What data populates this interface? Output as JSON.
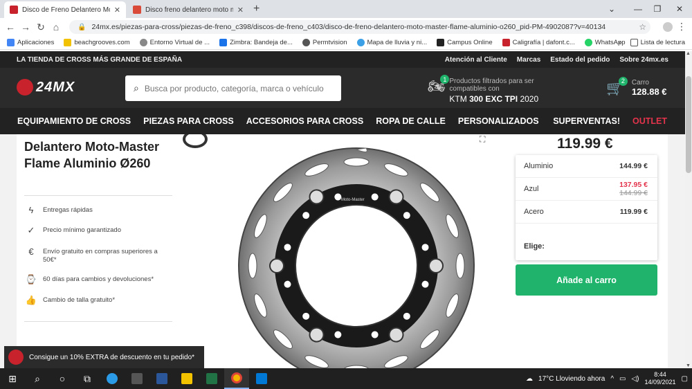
{
  "browser": {
    "tabs": [
      {
        "title": "Disco de Freno Delantero Moto-M",
        "active": true,
        "favicon_color": "#c8232c"
      },
      {
        "title": "Disco freno delantero moto más",
        "active": false,
        "favicon_color": "#d94a38"
      }
    ],
    "new_tab": "+",
    "url": "24mx.es/piezas-para-cross/piezas-de-freno_c398/discos-de-freno_c403/disco-de-freno-delantero-moto-master-flame-aluminio-o260_pid-PM-4902087?v=40134",
    "bookmarks": [
      {
        "label": "Aplicaciones",
        "color": "#4285f4"
      },
      {
        "label": "beachgrooves.com",
        "color": "#f2c200"
      },
      {
        "label": "Entorno Virtual de ...",
        "color": "#888888"
      },
      {
        "label": "Zimbra: Bandeja de...",
        "color": "#1a73e8"
      },
      {
        "label": "Permtvision",
        "color": "#555555"
      },
      {
        "label": "Mapa de lluvia y ni...",
        "color": "#3ba0e6"
      },
      {
        "label": "Campus Online",
        "color": "#222222"
      },
      {
        "label": "Caligrafía | dafont.c...",
        "color": "#c8232c"
      },
      {
        "label": "WhatsApp",
        "color": "#25d366"
      }
    ],
    "bookmarks_more": "»",
    "reading_list": "Lista de lectura"
  },
  "site": {
    "top_strip": {
      "slogan": "LA TIENDA DE CROSS MÁS GRANDE DE ESPAÑA",
      "links": [
        "Atención al Cliente",
        "Marcas",
        "Estado del pedido",
        "Sobre 24mx.es"
      ]
    },
    "logo": "24MX",
    "search": {
      "placeholder": "Busca por producto, categoría, marca o vehículo"
    },
    "vehicle": {
      "badge": "1",
      "text": "Productos filtrados para ser compatibles con",
      "model_prefix": "KTM",
      "model_bold": "300 EXC TPI",
      "model_year": "2020"
    },
    "cart": {
      "badge": "2",
      "label": "Carro",
      "total": "128.88 €"
    },
    "nav": [
      "EQUIPAMIENTO DE CROSS",
      "PIEZAS PARA CROSS",
      "ACCESORIOS PARA CROSS",
      "ROPA DE CALLE",
      "PERSONALIZADOS"
    ],
    "nav_right": {
      "superventas": "SUPERVENTAS!",
      "outlet": "OUTLET"
    }
  },
  "product": {
    "title": "Delantero Moto-Master Flame Aluminio Ø260",
    "price": "119.99 €",
    "benefits": [
      {
        "icon": "lightning-icon",
        "text": "Entregas rápidas"
      },
      {
        "icon": "checkmark-badge-icon",
        "text": "Precio mínimo garantizado"
      },
      {
        "icon": "euro-coin-icon",
        "text": "Envío gratuito en compras superiores a 50€*"
      },
      {
        "icon": "watch-icon",
        "text": "60 días para cambios y devoluciones*"
      },
      {
        "icon": "thumbs-up-icon",
        "text": "Cambio de talla gratuito*"
      }
    ],
    "options": [
      {
        "label": "Aluminio",
        "price": "144.99 €"
      },
      {
        "label": "Azul",
        "sale_price": "137.95 €",
        "old_price": "144.99 €"
      },
      {
        "label": "Acero",
        "price": "119.99 €"
      }
    ],
    "choose_label": "Elige:",
    "add_to_cart": "Añade al carro",
    "disc_brand_text": "Moto-Master"
  },
  "promo": {
    "text": "Consigue un 10% EXTRA de descuento en tu pedido*"
  },
  "taskbar": {
    "weather": "17°C  Lloviendo ahora",
    "time": "8:44",
    "date": "14/09/2021"
  },
  "colors": {
    "brand_red": "#c8232c",
    "green": "#1fb36b",
    "outlet_pink": "#e3344c",
    "dark": "#222222"
  }
}
